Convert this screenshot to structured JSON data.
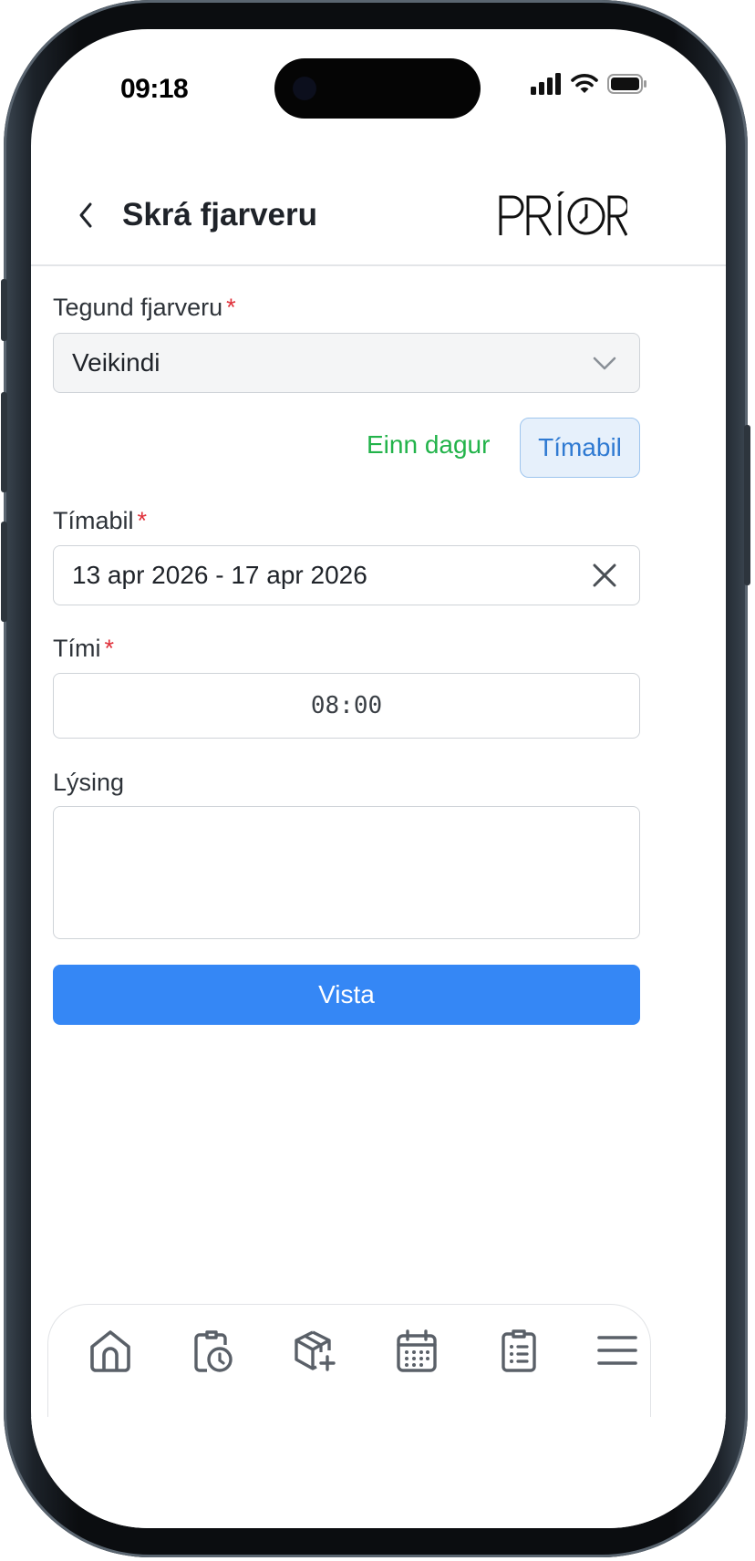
{
  "status_bar": {
    "time": "09:18"
  },
  "header": {
    "title": "Skrá fjarveru",
    "logo_text": "PRÍOR"
  },
  "form": {
    "type_label": "Tegund fjarveru",
    "type_value": "Veikindi",
    "required_mark": "*",
    "toggle_single_day": "Einn dagur",
    "toggle_range": "Tímabil",
    "period_label": "Tímabil",
    "period_value": "13 apr 2026 - 17 apr 2026",
    "time_label": "Tími",
    "time_value": "08:00",
    "description_label": "Lýsing",
    "description_value": "",
    "save_label": "Vista"
  },
  "colors": {
    "accent": "#3587f5",
    "required": "#e0313b",
    "single_day": "#22b34a",
    "range_selected_bg": "#e6f0fb"
  },
  "bottom_nav": {
    "items": [
      "home-icon",
      "clipboard-clock-icon",
      "box-add-icon",
      "calendar-icon",
      "checklist-icon",
      "menu-icon"
    ]
  }
}
